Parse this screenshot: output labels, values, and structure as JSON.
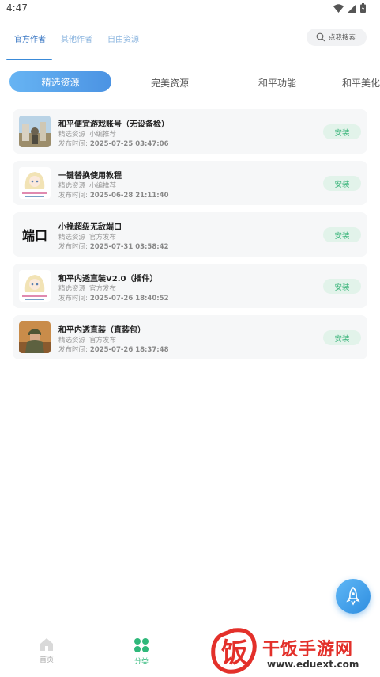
{
  "status_bar": {
    "time": "4:47"
  },
  "top_tabs": {
    "items": [
      {
        "label": "官方作者",
        "active": true
      },
      {
        "label": "其他作者",
        "active": false
      },
      {
        "label": "自由资源",
        "active": false
      }
    ],
    "search_placeholder": "点我搜索"
  },
  "categories": {
    "active": "精选资源",
    "items": [
      "完美资源",
      "和平功能",
      "和平美化"
    ]
  },
  "cards": [
    {
      "title": "和平便宜游戏账号（无设备检）",
      "tag1": "精选资源",
      "tag2": "小编推荐",
      "date_label": "发布时间:",
      "date": "2025-07-25 03:47:06",
      "action": "安装",
      "thumb": "game-scene"
    },
    {
      "title": "一键替换使用教程",
      "tag1": "精选资源",
      "tag2": "小编推荐",
      "date_label": "发布时间:",
      "date": "2025-06-28 21:11:40",
      "action": "安装",
      "thumb": "anime-girl"
    },
    {
      "title": "小挽超级无敌端口",
      "tag1": "精选资源",
      "tag2": "官方发布",
      "date_label": "发布时间:",
      "date": "2025-07-31 03:58:42",
      "action": "安装",
      "thumb": "text-port",
      "thumb_text": "端口"
    },
    {
      "title": "和平内透直装V2.0（插件）",
      "tag1": "精选资源",
      "tag2": "官方发布",
      "date_label": "发布时间:",
      "date": "2025-07-26 18:40:52",
      "action": "安装",
      "thumb": "anime-girl"
    },
    {
      "title": "和平内透直装（直装包）",
      "tag1": "精选资源",
      "tag2": "官方发布",
      "date_label": "发布时间:",
      "date": "2025-07-26 18:37:48",
      "action": "安装",
      "thumb": "soldier"
    }
  ],
  "bottom_nav": {
    "items": [
      {
        "label": "首页",
        "icon": "home-icon",
        "active": false
      },
      {
        "label": "分类",
        "icon": "grid-icon",
        "active": true
      }
    ]
  },
  "watermark": {
    "title": "干饭手游网",
    "url": "www.eduext.com",
    "logo_char": "饭"
  },
  "colors": {
    "accent": "#4b93e3",
    "install_text": "#3ab47a",
    "install_bg": "#e2f3ea",
    "nav_active": "#2fb87a",
    "watermark": "#e3302a"
  }
}
